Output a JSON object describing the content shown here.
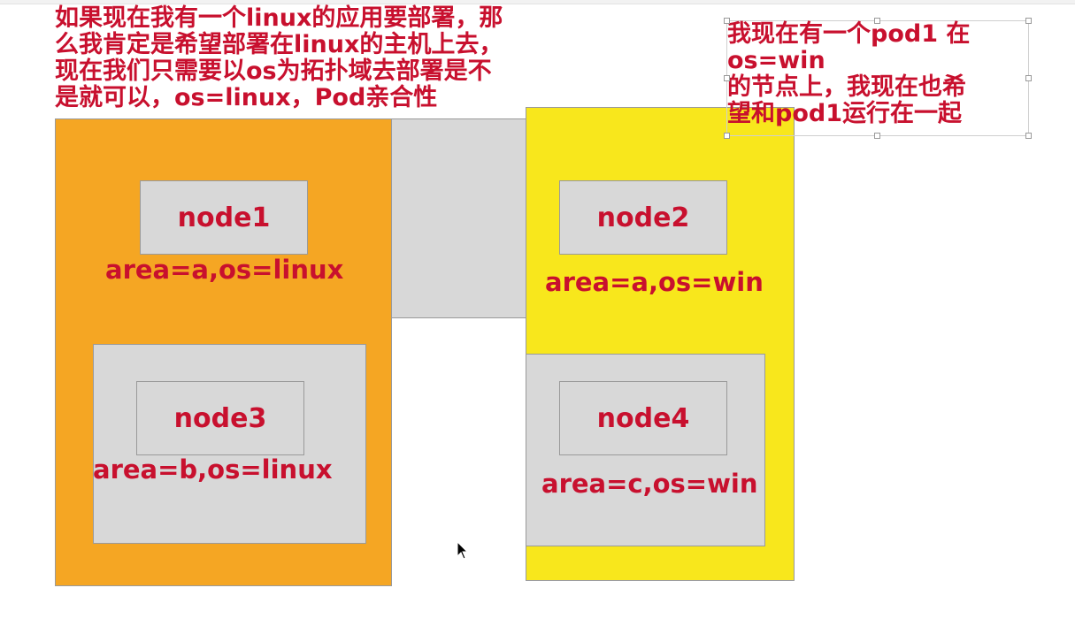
{
  "notes": {
    "left_text": "如果现在我有一个linux的应用要部署，那\n么我肯定是希望部署在linux的主机上去，\n现在我们只需要以os为拓扑域去部署是不\n是就可以，os=linux，Pod亲合性",
    "right_text": "我现在有一个pod1 在\nos=win\n的节点上，我现在也希\n望和pod1运行在一起"
  },
  "nodes": [
    {
      "name": "node1",
      "labels": "area=a,os=linux"
    },
    {
      "name": "node2",
      "labels": "area=a,os=win"
    },
    {
      "name": "node3",
      "labels": "area=b,os=linux"
    },
    {
      "name": "node4",
      "labels": "area=c,os=win"
    }
  ],
  "colors": {
    "text_red": "#c8102e",
    "linux_region": "#f5a623",
    "win_region": "#f8e71c",
    "node_gray": "#d8d8d8"
  },
  "icons": {
    "cursor": "mouse-pointer-icon"
  }
}
